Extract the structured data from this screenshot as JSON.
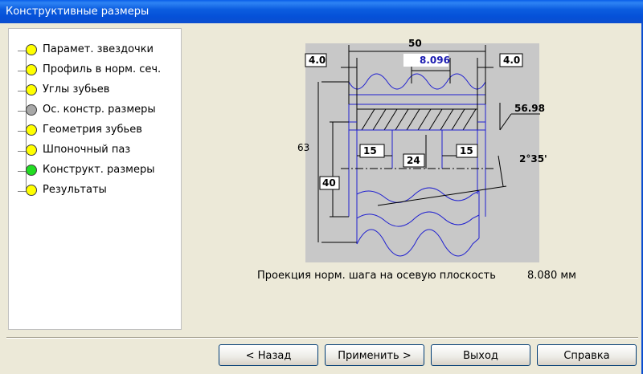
{
  "window": {
    "title": "Конструктивные размеры"
  },
  "tree": {
    "items": [
      {
        "label": "Парамет. звездочки",
        "status_color": "#FFFF00"
      },
      {
        "label": "Профиль в норм. сеч.",
        "status_color": "#FFFF00"
      },
      {
        "label": "Углы зубьев",
        "status_color": "#FFFF00"
      },
      {
        "label": "Ос. констр. размеры",
        "status_color": "#A8A8A8"
      },
      {
        "label": "Геометрия зубьев",
        "status_color": "#FFFF00"
      },
      {
        "label": "Шпоночный паз",
        "status_color": "#FFFF00"
      },
      {
        "label": "Конструкт. размеры",
        "status_color": "#22DD22"
      },
      {
        "label": "Результаты",
        "status_color": "#FFFF00"
      }
    ]
  },
  "drawing": {
    "dims": {
      "width_total": "50",
      "left_offset": "4.0",
      "right_offset": "4.0",
      "pitch": "8.096",
      "dia": "56.98",
      "height": "63",
      "hub_left": "15",
      "hub_right": "15",
      "bore": "24",
      "inner_height": "40",
      "angle": "2°35'"
    }
  },
  "projection": {
    "label": "Проекция норм. шага на осевую плоскость",
    "value": "8.080 мм"
  },
  "buttons": {
    "back": "< Назад",
    "apply": "Применить >",
    "exit": "Выход",
    "help": "Справка"
  }
}
